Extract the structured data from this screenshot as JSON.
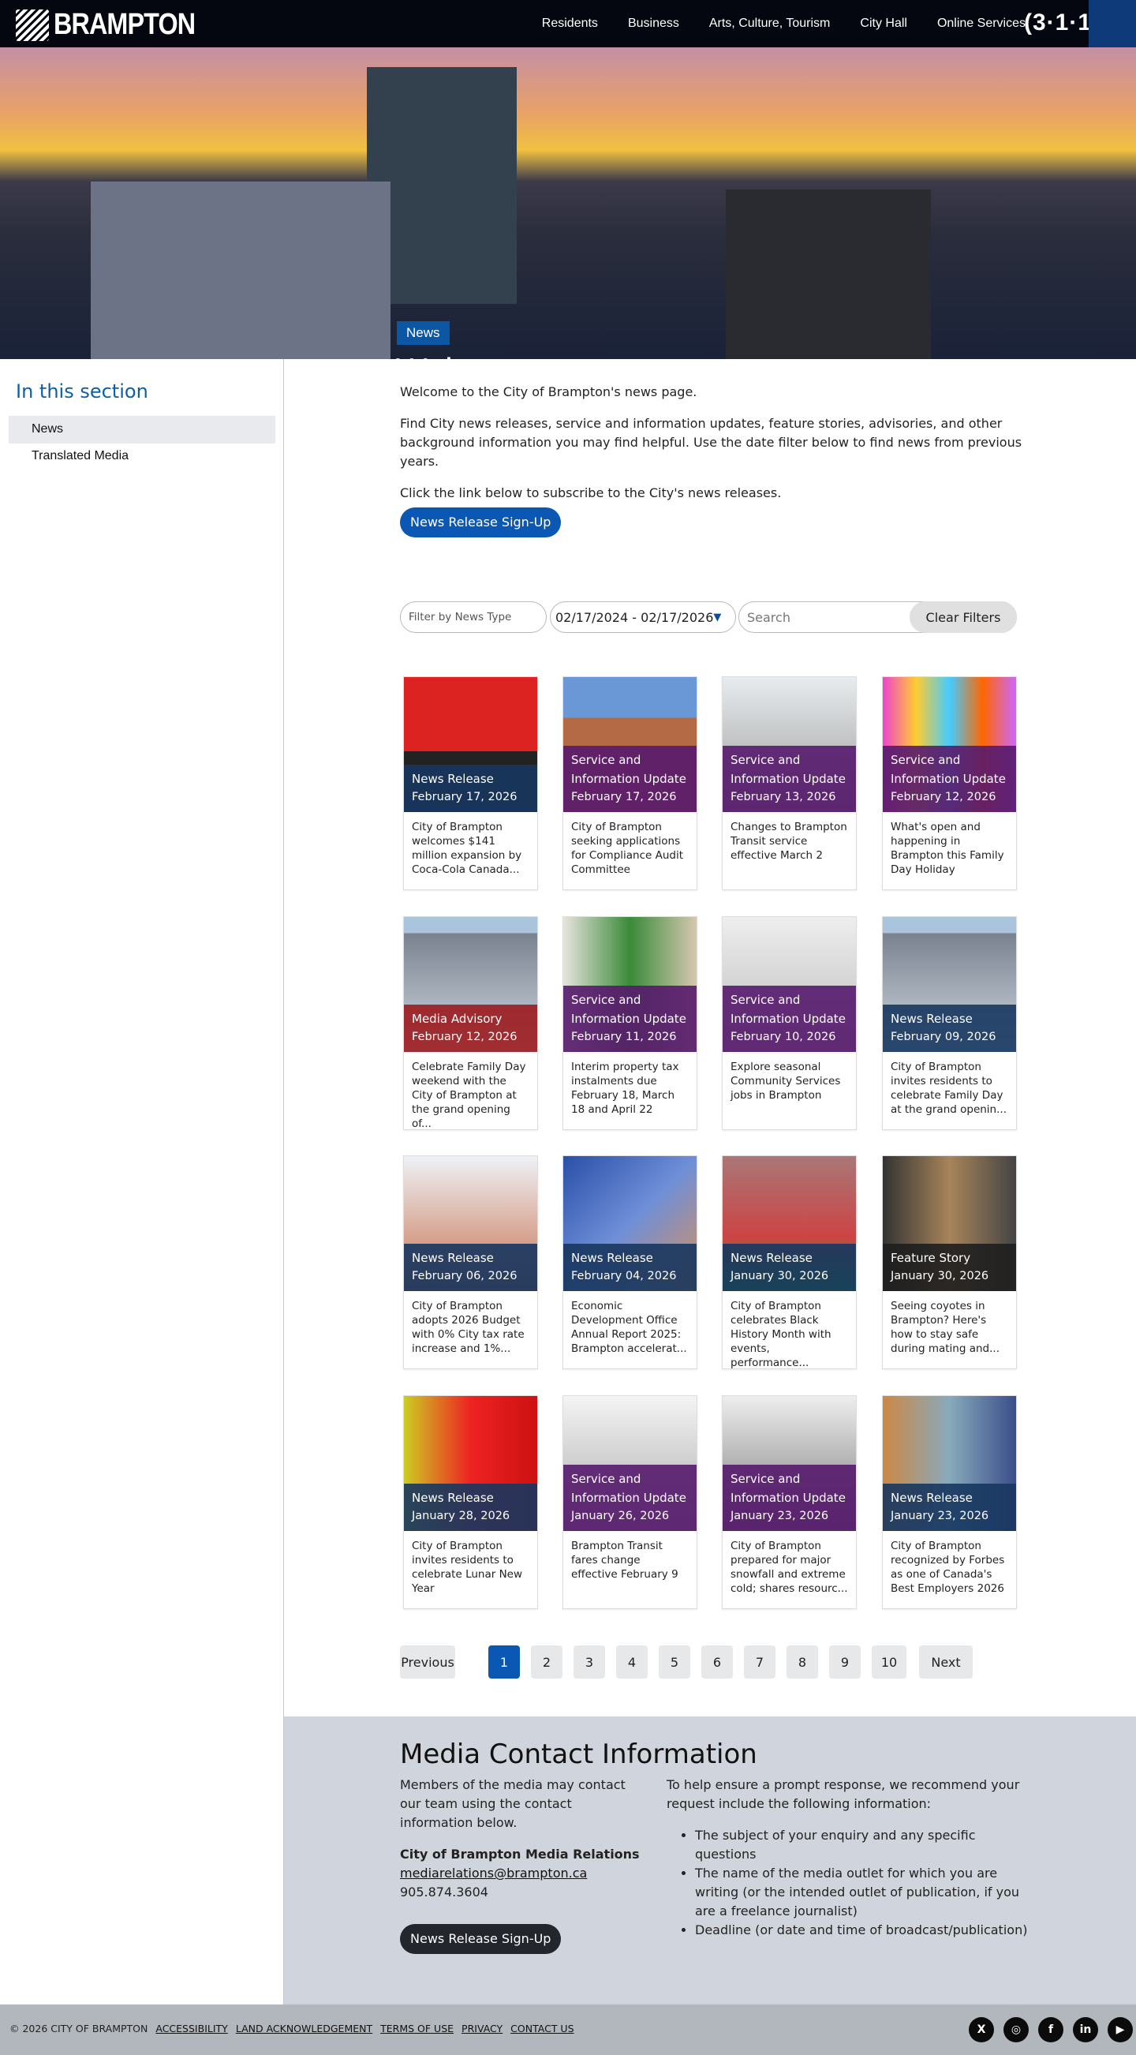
{
  "header": {
    "logo": "BRAMPTON",
    "nav": [
      "Residents",
      "Business",
      "Arts, Culture, Tourism",
      "City Hall",
      "Online Services"
    ],
    "badge_311": "(3·1·1"
  },
  "hero": {
    "tag": "News",
    "title": "Welcome"
  },
  "sidebar": {
    "heading": "In this section",
    "items": [
      {
        "label": "News"
      },
      {
        "label": "Translated Media"
      }
    ]
  },
  "intro": {
    "p1": "Welcome to the City of Brampton's news page.",
    "p2": "Find City news releases, service and information updates, feature stories, advisories, and other background information you may find helpful. Use the date filter below to find news from previous years.",
    "p3": "Click the link below to subscribe to the City's news releases.",
    "signup": "News Release Sign-Up"
  },
  "filters": {
    "type_placeholder": "Filter by News Type",
    "date_range": "02/17/2024 - 02/17/2026",
    "search_placeholder": "Search",
    "clear": "Clear Filters"
  },
  "colors": {
    "News Release": "#17365f",
    "Service and Information Update": "#571a6c",
    "Media Advisory": "#9a1b1e",
    "Feature Story": "#1e1e1e"
  },
  "cards": [
    {
      "type": "News Release",
      "date": "February 17, 2026",
      "title": "City of Brampton welcomes $141 million expansion by Coca-Cola Canada...",
      "img": "linear-gradient(#d22 0 55%,#222 55%)"
    },
    {
      "type": "Service and Information Update",
      "date": "February 17, 2026",
      "title": "City of Brampton seeking applications for Compliance Audit Committee",
      "img": "linear-gradient(#6a97d6 0 30%,#b36a45 30%)"
    },
    {
      "type": "Service and Information Update",
      "date": "February 13, 2026",
      "title": "Changes to Brampton Transit service effective March 2",
      "img": "linear-gradient(#e8ecee,#999)"
    },
    {
      "type": "Service and Information Update",
      "date": "February 12, 2026",
      "title": "What's open and happening in Brampton this Family Day Holiday",
      "img": "linear-gradient(90deg,#e4c,#fc3,#4cf,#f60,#c6f)"
    },
    {
      "type": "Media Advisory",
      "date": "February 12, 2026",
      "title": "Celebrate Family Day weekend with the City of Brampton at the grand opening of...",
      "img": "linear-gradient(#a9c4dc 0 12%,#7a8290 12%,#cfd8e0)"
    },
    {
      "type": "Service and Information Update",
      "date": "February 11, 2026",
      "title": "Interim property tax instalments due February 18, March 18 and April 22",
      "img": "linear-gradient(90deg,#e7e4de,#3a8a3a,#d6c7b0)"
    },
    {
      "type": "Service and Information Update",
      "date": "February 10, 2026",
      "title": "Explore seasonal Community Services jobs in Brampton",
      "img": "linear-gradient(#eee,#bbb)"
    },
    {
      "type": "News Release",
      "date": "February 09, 2026",
      "title": "City of Brampton invites residents to celebrate Family Day at the grand openin...",
      "img": "linear-gradient(#a9c4dc 0 12%,#7a8290 12%,#cfd8e0)"
    },
    {
      "type": "News Release",
      "date": "February 06, 2026",
      "title": "City of Brampton adopts 2026 Budget with 0% City tax rate increase and 1%...",
      "img": "linear-gradient(#eef2f6,#c87050)"
    },
    {
      "type": "News Release",
      "date": "February 04, 2026",
      "title": "Economic Development Office Annual Report 2025: Brampton accelerat...",
      "img": "linear-gradient(135deg,#2a4fa8,#6f8fd8,#d9905a)"
    },
    {
      "type": "News Release",
      "date": "January 30, 2026",
      "title": "City of Brampton celebrates Black History Month with events, performance...",
      "img": "linear-gradient(#a77,#c44 60%,#2a2)"
    },
    {
      "type": "Feature Story",
      "date": "January 30, 2026",
      "title": "Seeing coyotes in Brampton? Here's how to stay safe during mating and...",
      "img": "linear-gradient(90deg,#333,#a8845a,#444)"
    },
    {
      "type": "News Release",
      "date": "January 28, 2026",
      "title": "City of Brampton invites residents to celebrate Lunar New Year",
      "img": "linear-gradient(90deg,#cc2,#e22,#c11)"
    },
    {
      "type": "Service and Information Update",
      "date": "January 26, 2026",
      "title": "Brampton Transit fares change effective February 9",
      "img": "linear-gradient(#f4f4f4,#aaa)"
    },
    {
      "type": "Service and Information Update",
      "date": "January 23, 2026",
      "title": "City of Brampton prepared for major snowfall and extreme cold; shares resourc...",
      "img": "linear-gradient(#eee,#777)"
    },
    {
      "type": "News Release",
      "date": "January 23, 2026",
      "title": "City of Brampton recognized by Forbes as one of Canada's Best Employers 2026",
      "img": "linear-gradient(90deg,#c84,#8ab,#3a4e8a)"
    }
  ],
  "pagination": {
    "previous": "Previous",
    "pages": [
      "1",
      "2",
      "3",
      "4",
      "5",
      "6",
      "7",
      "8",
      "9",
      "10"
    ],
    "current": "1",
    "next": "Next"
  },
  "media": {
    "heading": "Media Contact Information",
    "intro": "Members of the media may contact our team using the contact information below.",
    "org": "City of Brampton Media Relations",
    "email": "mediarelations@brampton.ca",
    "phone": "905.874.3604",
    "signup": "News Release Sign-Up",
    "request_intro": "To help ensure a prompt response, we recommend your request include the following information:",
    "bullets": [
      "The subject of your enquiry and any specific questions",
      "The name of the media outlet for which you are writing (or the intended outlet of publication, if you are a freelance journalist)",
      "Deadline (or date and time of broadcast/publication)"
    ]
  },
  "footer": {
    "copyright": "© 2026 CITY OF BRAMPTON",
    "links": [
      "ACCESSIBILITY",
      "LAND ACKNOWLEDGEMENT",
      "TERMS OF USE",
      "PRIVACY",
      "CONTACT US"
    ],
    "social": [
      {
        "name": "x",
        "glyph": "X"
      },
      {
        "name": "instagram",
        "glyph": "◎"
      },
      {
        "name": "facebook",
        "glyph": "f"
      },
      {
        "name": "linkedin",
        "glyph": "in"
      },
      {
        "name": "youtube",
        "glyph": "▶"
      }
    ]
  }
}
